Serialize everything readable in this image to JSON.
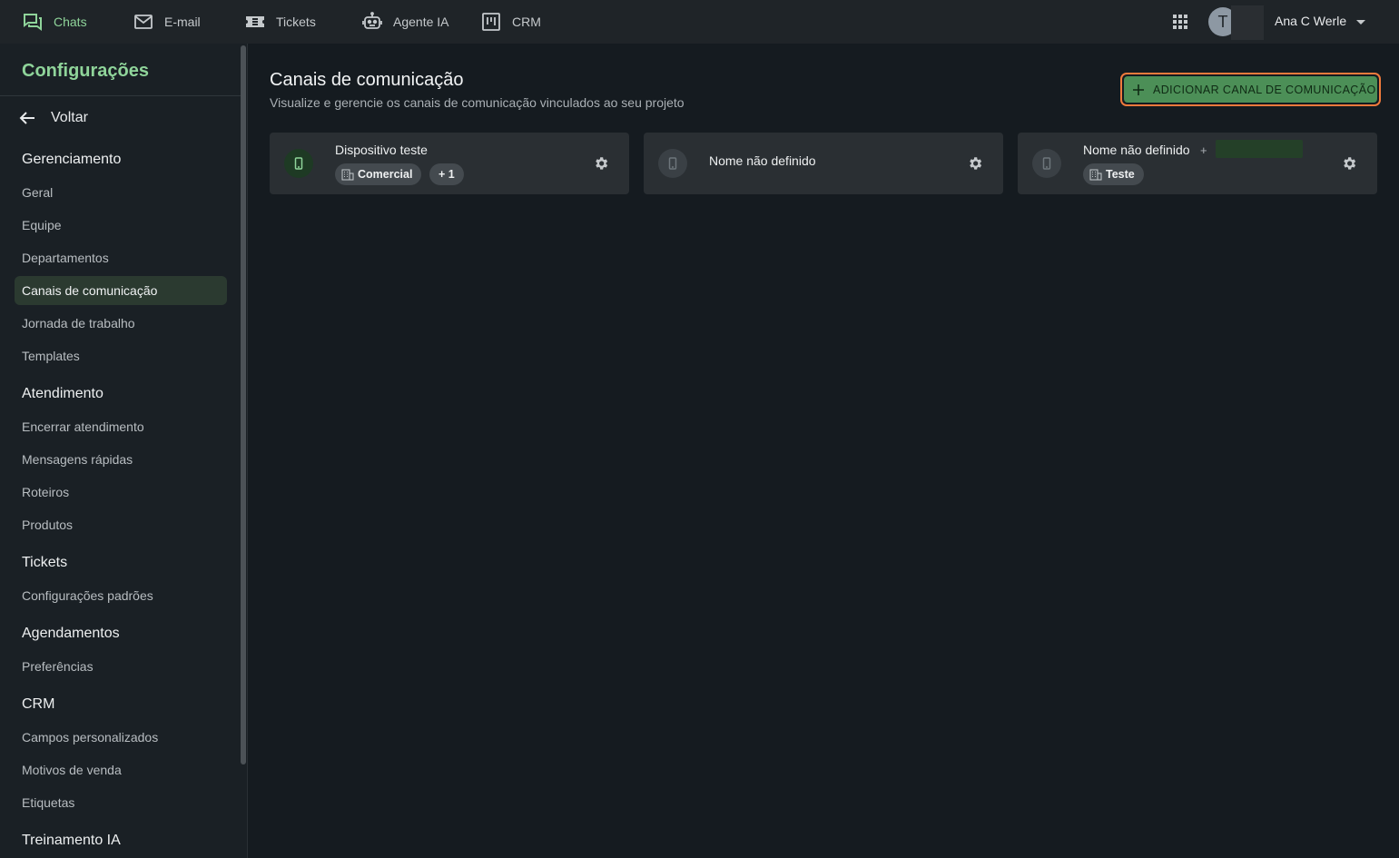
{
  "topnav": {
    "items": [
      {
        "label": "Chats",
        "icon": "chat-icon"
      },
      {
        "label": "E-mail",
        "icon": "mail-icon"
      },
      {
        "label": "Tickets",
        "icon": "ticket-icon"
      },
      {
        "label": "Agente IA",
        "icon": "robot-icon"
      },
      {
        "label": "CRM",
        "icon": "kanban-icon"
      }
    ],
    "avatar_initial": "T",
    "user_name": "Ana C Werle"
  },
  "sidebar": {
    "title": "Configurações",
    "back_label": "Voltar",
    "sections": [
      {
        "label": "Gerenciamento",
        "items": [
          "Geral",
          "Equipe",
          "Departamentos",
          "Canais de comunicação",
          "Jornada de trabalho",
          "Templates"
        ]
      },
      {
        "label": "Atendimento",
        "items": [
          "Encerrar atendimento",
          "Mensagens rápidas",
          "Roteiros",
          "Produtos"
        ]
      },
      {
        "label": "Tickets",
        "items": [
          "Configurações padrões"
        ]
      },
      {
        "label": "Agendamentos",
        "items": [
          "Preferências"
        ]
      },
      {
        "label": "CRM",
        "items": [
          "Campos personalizados",
          "Motivos de venda",
          "Etiquetas"
        ]
      },
      {
        "label": "Treinamento IA",
        "items": []
      }
    ],
    "active_item": "Canais de comunicação"
  },
  "main": {
    "title": "Canais de comunicação",
    "subtitle": "Visualize e gerencie os canais de comunicação vinculados ao seu projeto",
    "add_button": "ADICIONAR CANAL DE COMUNICAÇÃO",
    "channels": [
      {
        "name": "Dispositivo teste",
        "status": "connected",
        "tags": [
          "Comercial"
        ],
        "extra_tags": "+ 1"
      },
      {
        "name": "Nome não definido",
        "status": "disconnected",
        "tags": []
      },
      {
        "name": "Nome não definido",
        "status": "disconnected",
        "plus": "+",
        "tags": [
          "Teste"
        ]
      }
    ]
  },
  "colors": {
    "accent": "#8fd49a",
    "button_bg": "#4c8f57",
    "highlight_border": "#f07a3c",
    "background": "#151b20"
  }
}
